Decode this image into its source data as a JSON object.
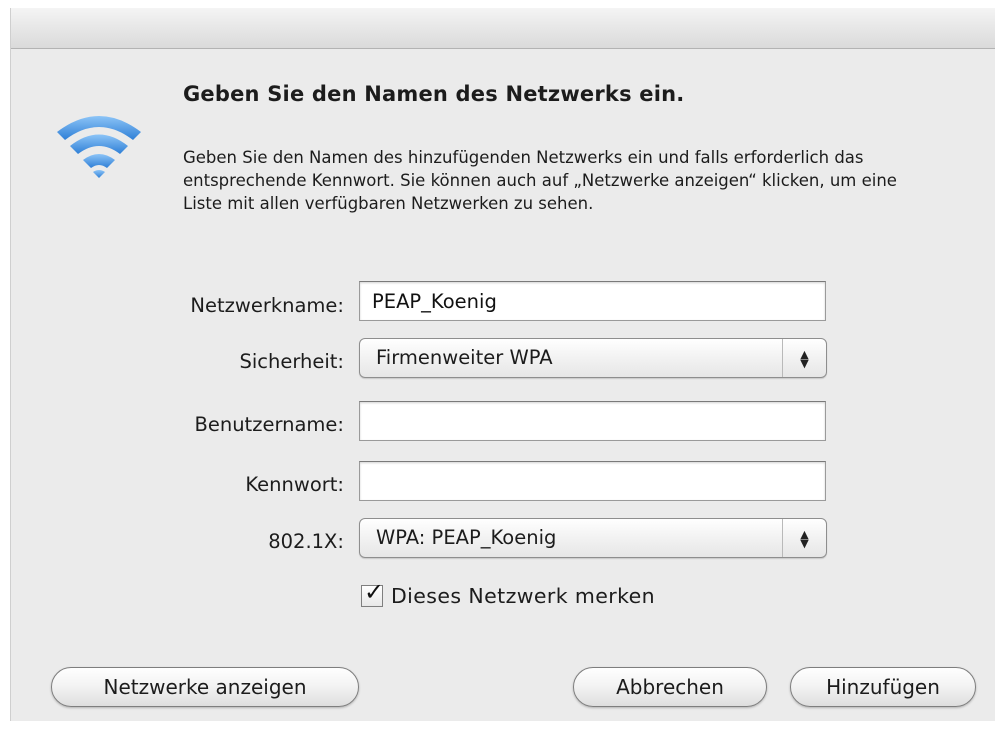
{
  "dialog": {
    "heading": "Geben Sie den Namen des Netzwerks ein.",
    "description": "Geben Sie den Namen des hinzufügenden Netzwerks ein und falls erforderlich das entsprechende Kennwort. Sie können auch auf „Netzwerke anzeigen“ klicken, um eine Liste mit allen verfügbaren Netzwerken zu sehen.",
    "icon": "wifi-icon"
  },
  "form": {
    "network_name": {
      "label": "Netzwerkname:",
      "value": "PEAP_Koenig"
    },
    "security": {
      "label": "Sicherheit:",
      "value": "Firmenweiter WPA"
    },
    "username": {
      "label": "Benutzername:",
      "value": ""
    },
    "password": {
      "label": "Kennwort:",
      "value": ""
    },
    "eap": {
      "label": "802.1X:",
      "value": "WPA: PEAP_Koenig"
    },
    "remember": {
      "label": "Dieses Netzwerk merken",
      "checked": true
    }
  },
  "buttons": {
    "show_networks": "Netzwerke anzeigen",
    "cancel": "Abbrechen",
    "add": "Hinzufügen"
  },
  "colors": {
    "wifi_blue": "#3f8fe0",
    "dialog_bg": "#ebebeb"
  }
}
